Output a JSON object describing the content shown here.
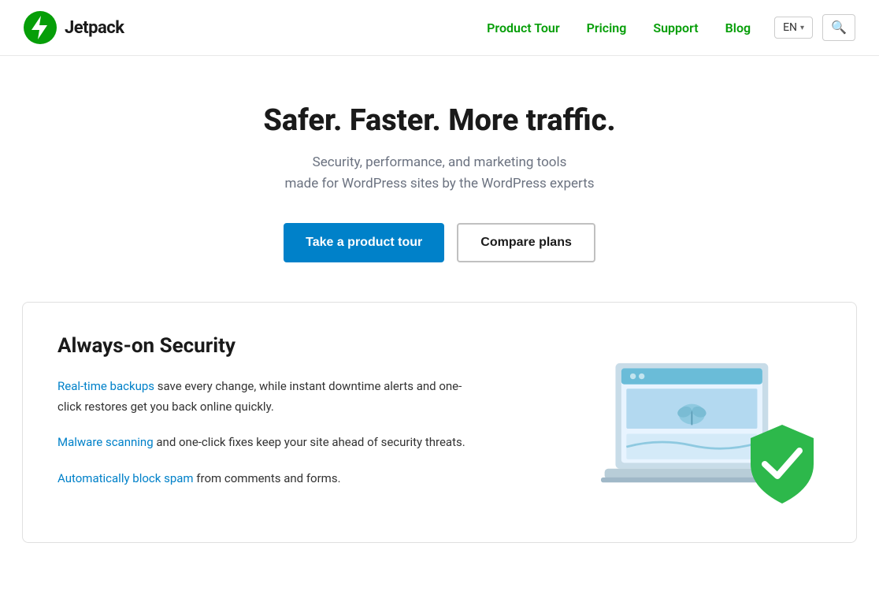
{
  "header": {
    "logo_text": "Jetpack",
    "nav": {
      "product_tour": "Product Tour",
      "pricing": "Pricing",
      "support": "Support",
      "blog": "Blog"
    },
    "lang": "EN",
    "search_icon": "🔍"
  },
  "hero": {
    "title": "Safer. Faster. More traffic.",
    "subtitle_line1": "Security, performance, and marketing tools",
    "subtitle_line2": "made for WordPress sites by the WordPress experts",
    "btn_primary": "Take a product tour",
    "btn_secondary": "Compare plans"
  },
  "security": {
    "title": "Always-on Security",
    "paragraph1_pre": "save every change, while instant downtime alerts and one-click restores get you back online quickly.",
    "paragraph1_link": "Real-time backups",
    "paragraph2_pre": "and one-click fixes keep your site ahead of security threats.",
    "paragraph2_link": "Malware scanning",
    "paragraph3_pre": "from comments and forms.",
    "paragraph3_link": "Automatically block spam"
  }
}
